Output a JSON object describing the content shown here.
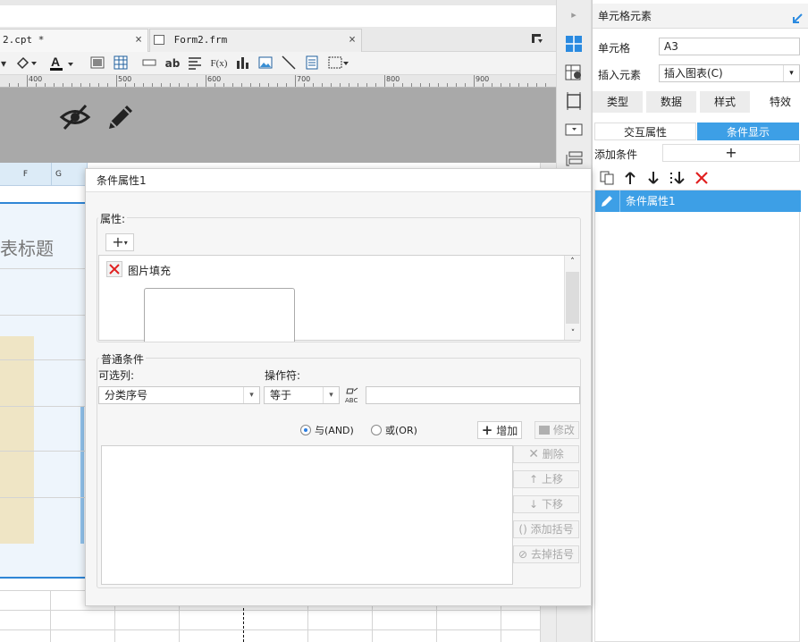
{
  "tabs": [
    {
      "label": "2.cpt *",
      "close": "×"
    },
    {
      "label": "Form2.frm",
      "close": "×"
    }
  ],
  "toolbar": {
    "text_ab": "ab",
    "formula": "F(x)"
  },
  "ruler": [
    "400",
    "500",
    "600",
    "700",
    "800",
    "900"
  ],
  "sheet": {
    "col_f": "F",
    "col_g": "G",
    "title_fragment": "表标题"
  },
  "panel": {
    "title": "单元格元素",
    "cell_label": "单元格",
    "cell_value": "A3",
    "insert_label": "插入元素",
    "insert_value": "插入图表(C)",
    "tabs": [
      "类型",
      "数据",
      "样式",
      "特效"
    ],
    "subtabs": [
      "交互属性",
      "条件显示"
    ],
    "add_condition_label": "添加条件",
    "add_symbol": "+",
    "condition_item": "条件属性1"
  },
  "dialog": {
    "title": "条件属性1",
    "attr_label": "属性:",
    "add_attr": "+",
    "attr_item": "图片填充",
    "common_label": "普通条件",
    "column_label": "可选列:",
    "column_value": "分类序号",
    "operator_label": "操作符:",
    "operator_value": "等于",
    "value_input": "",
    "and_label": "与(AND)",
    "or_label": "或(OR)",
    "add_btn": "增加",
    "modify_btn": "修改",
    "delete_btn": "删除",
    "up_btn": "上移",
    "down_btn": "下移",
    "add_paren_btn": "添加括号",
    "remove_paren_btn": "去掉括号"
  },
  "colors": {
    "accent": "#3d9fe6",
    "delete_red": "#e02020",
    "beige_chart": "#efe5c5"
  }
}
